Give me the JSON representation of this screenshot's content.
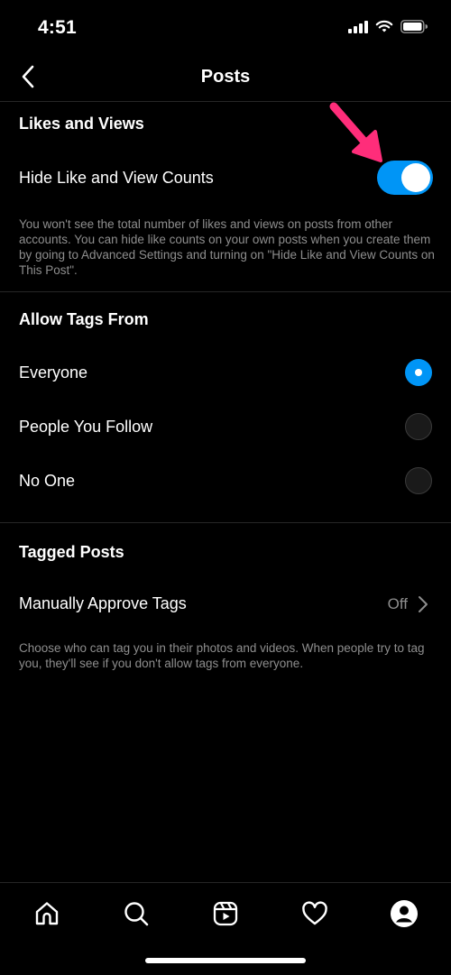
{
  "status_bar": {
    "time": "4:51",
    "icons": [
      "signal-icon",
      "wifi-icon",
      "battery-icon"
    ]
  },
  "header": {
    "title": "Posts",
    "back_icon": "chevron-left-icon"
  },
  "likes_views": {
    "section_title": "Likes and Views",
    "toggle_label": "Hide Like and View Counts",
    "toggle_on": true,
    "helper": "You won't see the total number of likes and views on posts from other accounts. You can hide like counts on your own posts when you create them by going to Advanced Settings and turning on \"Hide Like and View Counts on This Post\"."
  },
  "allow_tags": {
    "section_title": "Allow Tags From",
    "options": [
      {
        "label": "Everyone",
        "selected": true
      },
      {
        "label": "People You Follow",
        "selected": false
      },
      {
        "label": "No One",
        "selected": false
      }
    ]
  },
  "tagged_posts": {
    "section_title": "Tagged Posts",
    "approve_label": "Manually Approve Tags",
    "approve_value": "Off",
    "helper": "Choose who can tag you in their photos and videos. When people try to tag you, they'll see if you don't allow tags from everyone."
  },
  "bottom_nav": {
    "items": [
      "home-icon",
      "search-icon",
      "reels-icon",
      "heart-icon",
      "profile-icon"
    ]
  },
  "colors": {
    "accent": "#0095f6",
    "annotation": "#ff2d7a",
    "secondary_text": "#8e8e8e",
    "divider": "#262626"
  }
}
